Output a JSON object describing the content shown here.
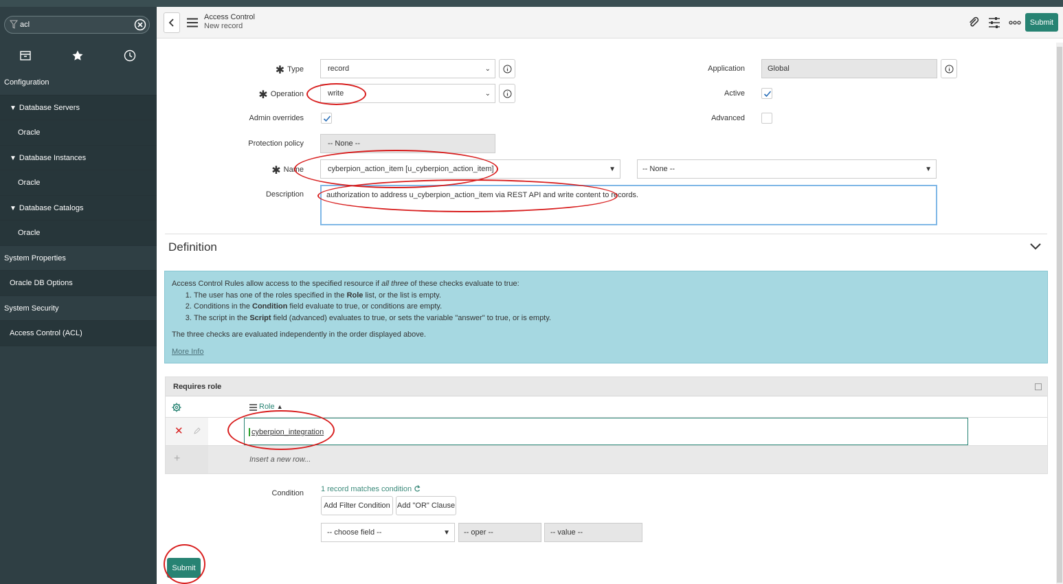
{
  "sidebar": {
    "filter_value": "acl",
    "nav": [
      {
        "label": "Configuration",
        "level": 0,
        "expanded": false
      },
      {
        "label": "Database Servers",
        "level": 1,
        "expanded": true
      },
      {
        "label": "Oracle",
        "level": 2
      },
      {
        "label": "Database Instances",
        "level": 1,
        "expanded": true
      },
      {
        "label": "Oracle",
        "level": 2
      },
      {
        "label": "Database Catalogs",
        "level": 1,
        "expanded": true
      },
      {
        "label": "Oracle",
        "level": 2
      },
      {
        "label": "System Properties",
        "level": 0
      },
      {
        "label": "Oracle DB Options",
        "level": 1
      },
      {
        "label": "System Security",
        "level": 0
      },
      {
        "label": "Access Control (ACL)",
        "level": 1
      }
    ]
  },
  "header": {
    "title": "Access Control",
    "subtitle": "New record",
    "submit_label": "Submit"
  },
  "form": {
    "type_label": "Type",
    "type_value": "record",
    "operation_label": "Operation",
    "operation_value": "write",
    "admin_overrides_label": "Admin overrides",
    "admin_overrides_checked": true,
    "protection_policy_label": "Protection policy",
    "protection_policy_value": "-- None --",
    "name_label": "Name",
    "name_value": "cyberpion_action_item [u_cyberpion_action_item]",
    "name_field_value": "-- None --",
    "description_label": "Description",
    "description_value": "authorization to address u_cyberpion_action_item via REST API and write content to records.",
    "application_label": "Application",
    "application_value": "Global",
    "active_label": "Active",
    "active_checked": true,
    "advanced_label": "Advanced",
    "advanced_checked": false
  },
  "definition": {
    "title": "Definition",
    "intro_before": "Access Control Rules allow access to the specified resource if ",
    "intro_em": "all three",
    "intro_after": " of these checks evaluate to true:",
    "item1_a": "The user has one of the roles specified in the ",
    "item1_b": "Role",
    "item1_c": " list, or the list is empty.",
    "item2_a": "Conditions in the ",
    "item2_b": "Condition",
    "item2_c": " field evaluate to true, or conditions are empty.",
    "item3_a": "The script in the ",
    "item3_b": "Script",
    "item3_c": " field (advanced) evaluates to true, or sets the variable \"answer\" to true, or is empty.",
    "note": "The three checks are evaluated independently in the order displayed above.",
    "more_info": "More Info"
  },
  "requires_role": {
    "title": "Requires role",
    "column_label": "Role",
    "role_value": "cyberpion_integration",
    "insert_row": "Insert a new row..."
  },
  "condition": {
    "label": "Condition",
    "match_text": "1 record matches condition",
    "add_filter": "Add Filter Condition",
    "add_or": "Add \"OR\" Clause",
    "choose_field": "-- choose field --",
    "oper": "-- oper --",
    "value": "-- value --"
  },
  "footer": {
    "submit_label": "Submit"
  },
  "colors": {
    "sidebar_bg": "#2f3f44",
    "accent_green": "#278373",
    "info_bg": "#a6d8e1",
    "annotation_red": "#d81e1e"
  }
}
